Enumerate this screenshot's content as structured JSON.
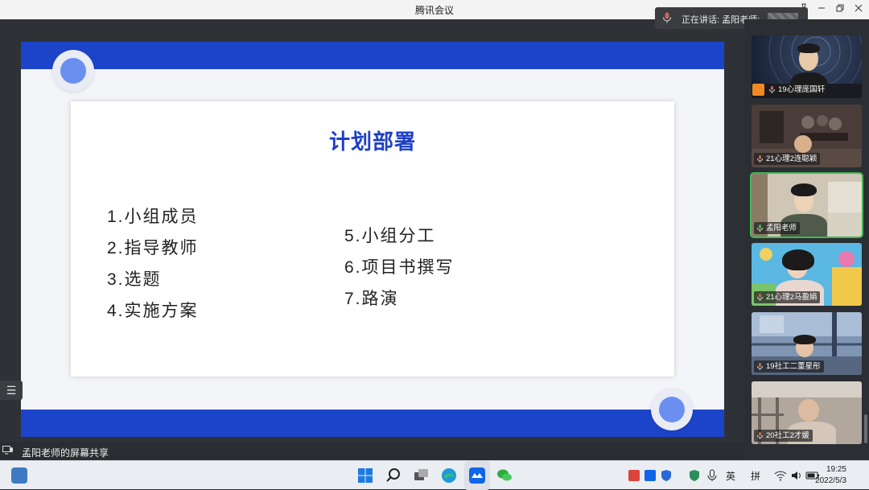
{
  "window": {
    "title": "腾讯会议"
  },
  "speaking": {
    "label": "正在讲话: 孟阳老师;"
  },
  "slide": {
    "heading": "计划部署",
    "left_items": [
      "1.小组成员",
      "2.指导教师",
      "3.选题",
      "4.实施方案"
    ],
    "right_items": [
      "5.小组分工",
      "6.项目书撰写",
      "7.路演"
    ]
  },
  "share_label": "孟阳老师的屏幕共享",
  "participants": [
    {
      "name": "19心理庞国轩",
      "active": false
    },
    {
      "name": "21心理2连聪颖",
      "active": false
    },
    {
      "name": "孟阳老师",
      "active": true
    },
    {
      "name": "21心理2马盈娟",
      "active": false
    },
    {
      "name": "19社工二董星彤",
      "active": false
    },
    {
      "name": "20社工2才媛",
      "active": false
    }
  ],
  "tray": {
    "lang1": "英",
    "lang2": "拼"
  },
  "clock": {
    "time": "19:25",
    "date": "2022/5/3"
  },
  "colors": {
    "accent": "#1c44c8",
    "heading": "#1e3fc7",
    "speaking_green": "#3fb950"
  }
}
